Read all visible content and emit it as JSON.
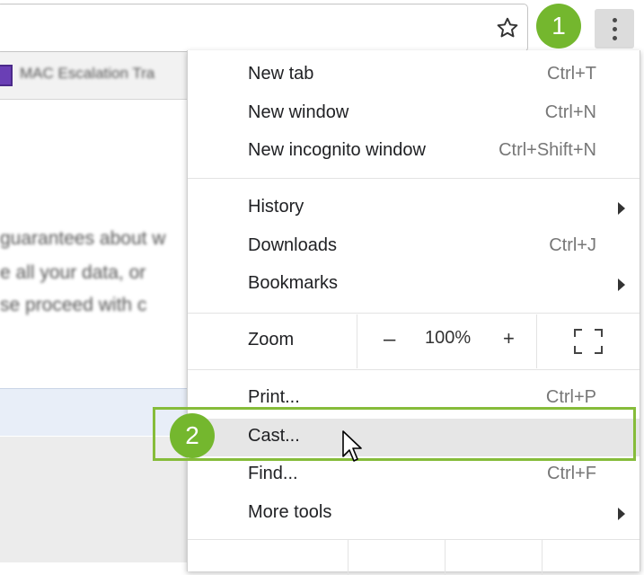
{
  "browser": {
    "bookmark_label": "MAC Escalation Tra",
    "page_lines": [
      "guarantees about w",
      "e all your data, or",
      "se proceed with c"
    ]
  },
  "menu": {
    "items_group1": [
      {
        "label": "New tab",
        "shortcut": "Ctrl+T"
      },
      {
        "label": "New window",
        "shortcut": "Ctrl+N"
      },
      {
        "label": "New incognito window",
        "shortcut": "Ctrl+Shift+N"
      }
    ],
    "items_group2": [
      {
        "label": "History",
        "shortcut": ""
      },
      {
        "label": "Downloads",
        "shortcut": "Ctrl+J"
      },
      {
        "label": "Bookmarks",
        "shortcut": ""
      }
    ],
    "zoom": {
      "label": "Zoom",
      "minus": "–",
      "value": "100%",
      "plus": "+"
    },
    "items_group3": [
      {
        "label": "Print...",
        "shortcut": "Ctrl+P"
      },
      {
        "label": "Cast...",
        "shortcut": ""
      },
      {
        "label": "Find...",
        "shortcut": "Ctrl+F"
      },
      {
        "label": "More tools",
        "shortcut": ""
      }
    ]
  },
  "annotations": {
    "step1": "1",
    "step2": "2",
    "accent": "#74b72e"
  }
}
